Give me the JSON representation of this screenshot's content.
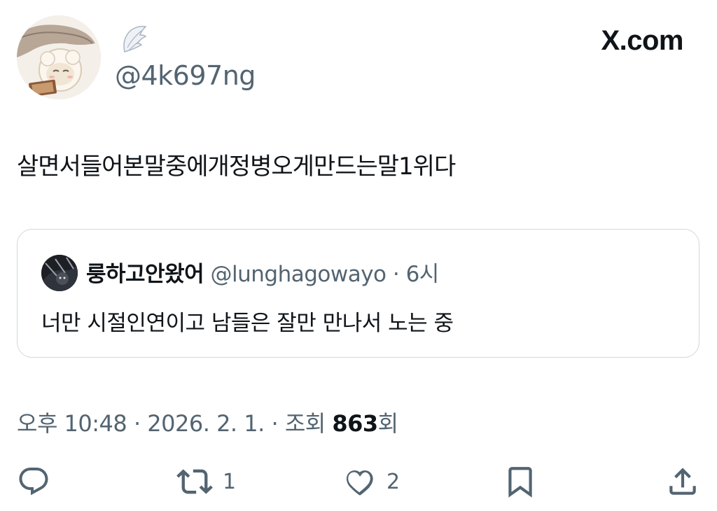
{
  "author": {
    "handle": "@4k697ng",
    "avatar_icon": "sheep-avatar",
    "badge_icon": "angel-wing-icon"
  },
  "brand": {
    "label": "X.com"
  },
  "tweet": {
    "text": "살면서들어본말중에개정병오게만드는말1위다"
  },
  "quote": {
    "avatar_icon": "dark-profile-avatar",
    "name": "룽하고안왔어",
    "meta": "@lunghagowayo · 6시",
    "text": "너만 시절인연이고 남들은 잘만 만나서 노는 중"
  },
  "meta": {
    "time_date": "오후 10:48 · 2026. 2. 1. · 조회 ",
    "views_count": "863",
    "views_suffix": "회"
  },
  "actions": {
    "reply_icon": "reply-icon",
    "retweet_icon": "retweet-icon",
    "retweet_count": "1",
    "like_icon": "heart-icon",
    "like_count": "2",
    "bookmark_icon": "bookmark-icon",
    "share_icon": "share-icon"
  },
  "colors": {
    "text_primary": "#0f1419",
    "text_secondary": "#536471",
    "border": "#cfd9de"
  }
}
